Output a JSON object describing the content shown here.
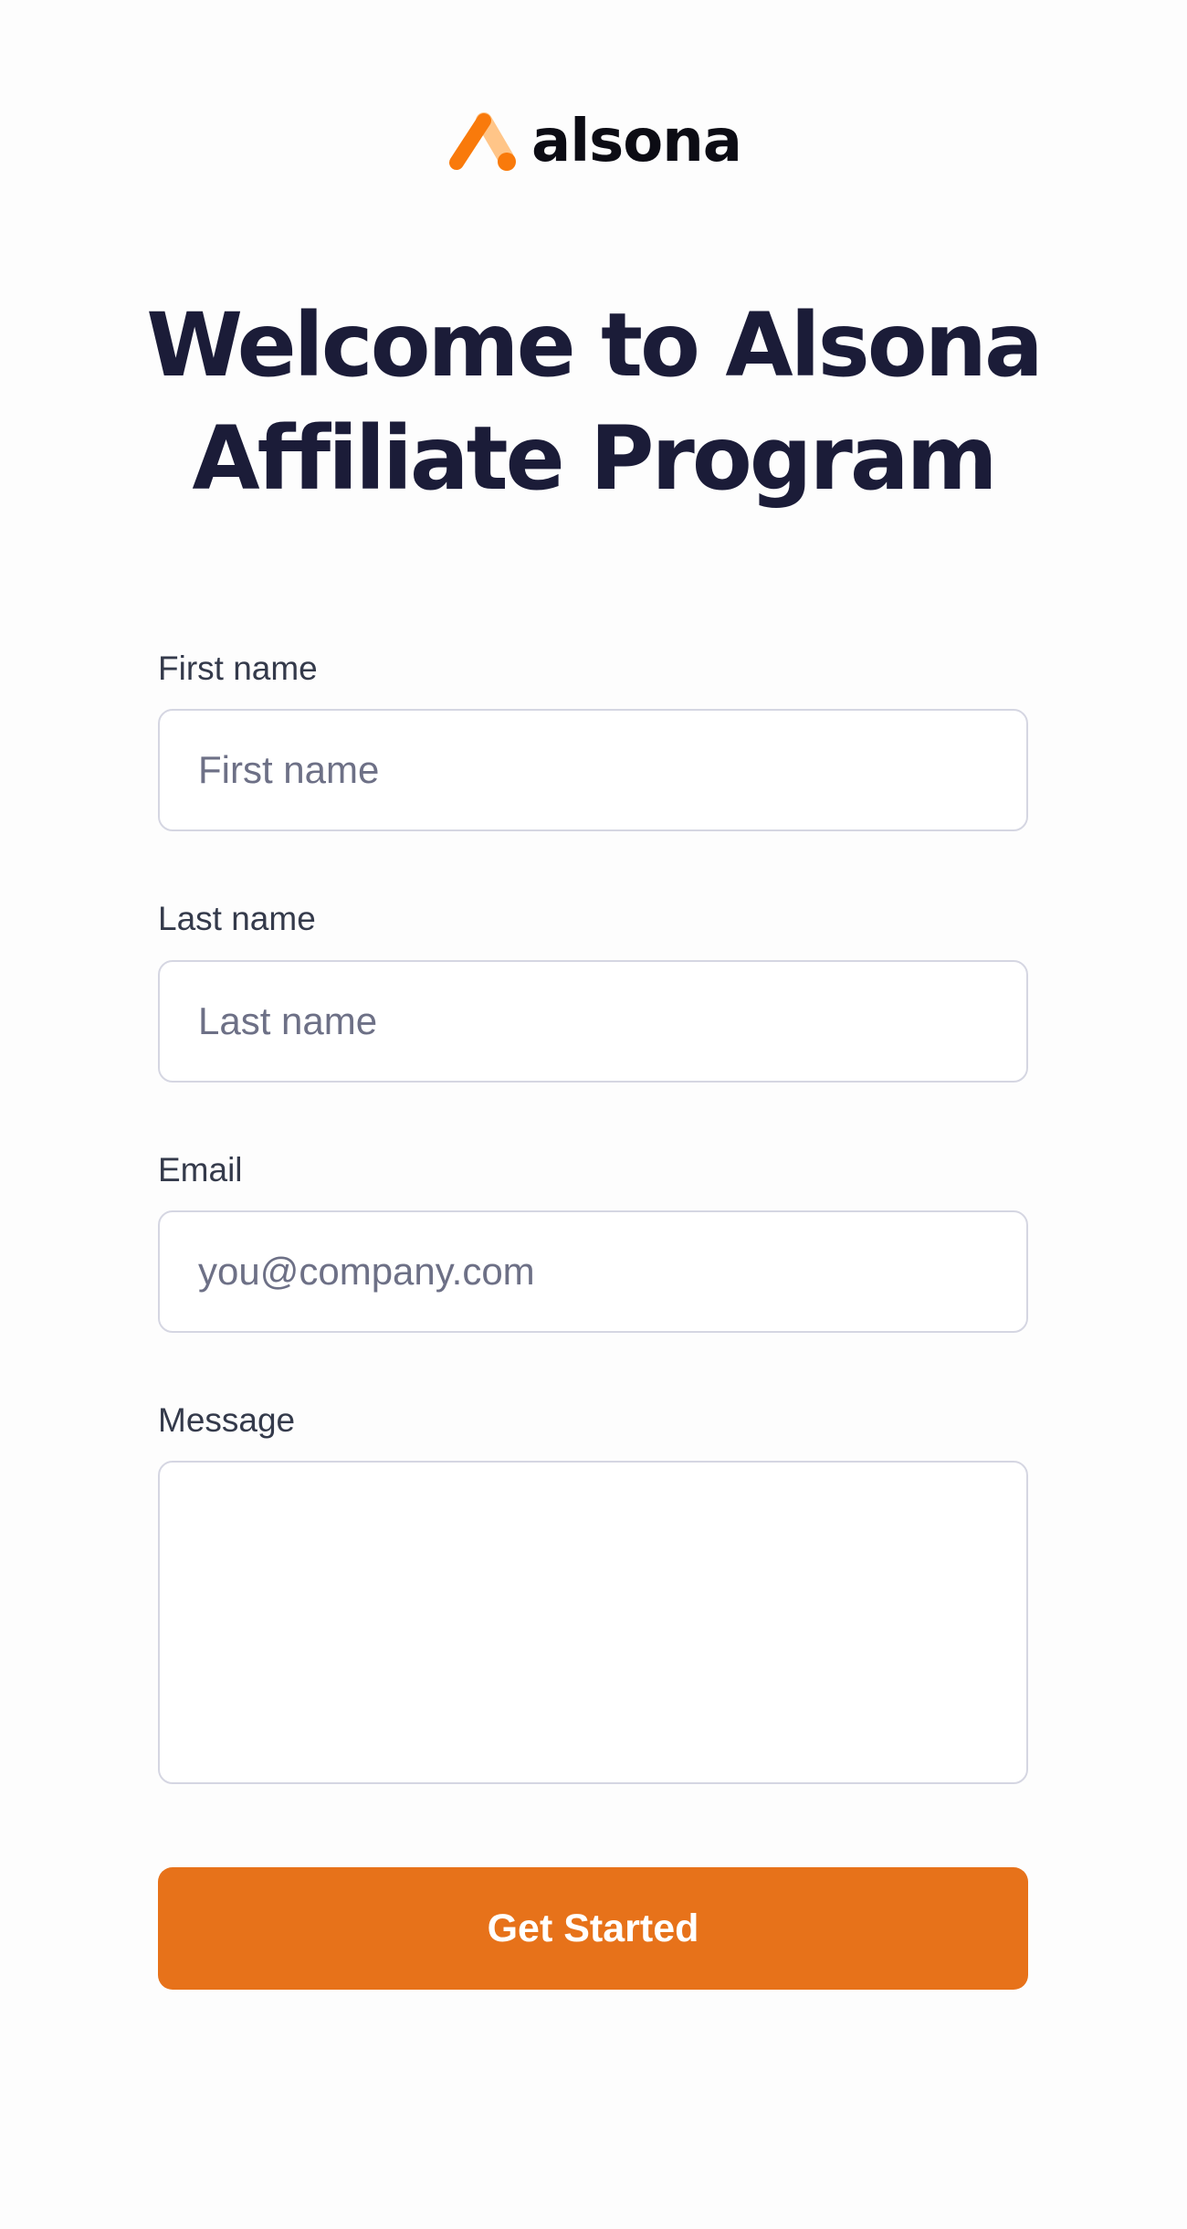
{
  "brand": {
    "name": "alsona",
    "accent_color": "#e7721a",
    "logo_mark_light": "#ffc588",
    "logo_mark_dark": "#f97a0b"
  },
  "header": {
    "title_line_1": "Welcome to Alsona",
    "title_line_2": "Affiliate Program"
  },
  "form": {
    "first_name": {
      "label": "First name",
      "placeholder": "First name",
      "value": ""
    },
    "last_name": {
      "label": "Last name",
      "placeholder": "Last name",
      "value": ""
    },
    "email": {
      "label": "Email",
      "placeholder": "you@company.com",
      "value": ""
    },
    "message": {
      "label": "Message",
      "placeholder": "",
      "value": ""
    },
    "submit_label": "Get Started"
  }
}
